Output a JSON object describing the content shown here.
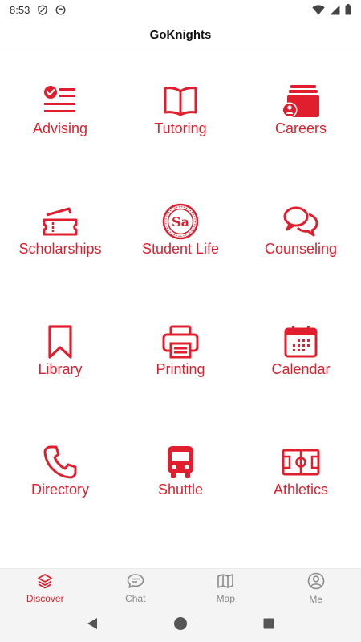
{
  "status_bar": {
    "time": "8:53"
  },
  "header": {
    "title": "GoKnights"
  },
  "colors": {
    "accent": "#e01e2e",
    "inactive": "#888888"
  },
  "tiles": [
    {
      "label": "Advising",
      "icon": "checklist-icon"
    },
    {
      "label": "Tutoring",
      "icon": "book-icon"
    },
    {
      "label": "Careers",
      "icon": "careers-icon"
    },
    {
      "label": "Scholarships",
      "icon": "ticket-icon"
    },
    {
      "label": "Student Life",
      "icon": "student-life-logo-icon"
    },
    {
      "label": "Counseling",
      "icon": "chat-bubbles-icon"
    },
    {
      "label": "Library",
      "icon": "bookmark-icon"
    },
    {
      "label": "Printing",
      "icon": "printer-icon"
    },
    {
      "label": "Calendar",
      "icon": "calendar-icon"
    },
    {
      "label": "Directory",
      "icon": "phone-icon"
    },
    {
      "label": "Shuttle",
      "icon": "bus-icon"
    },
    {
      "label": "Athletics",
      "icon": "field-icon"
    }
  ],
  "tile_logo": {
    "text": "Sa"
  },
  "bottom_nav": [
    {
      "label": "Discover",
      "icon": "layers-icon",
      "active": true
    },
    {
      "label": "Chat",
      "icon": "chat-icon",
      "active": false
    },
    {
      "label": "Map",
      "icon": "map-icon",
      "active": false
    },
    {
      "label": "Me",
      "icon": "user-icon",
      "active": false
    }
  ]
}
